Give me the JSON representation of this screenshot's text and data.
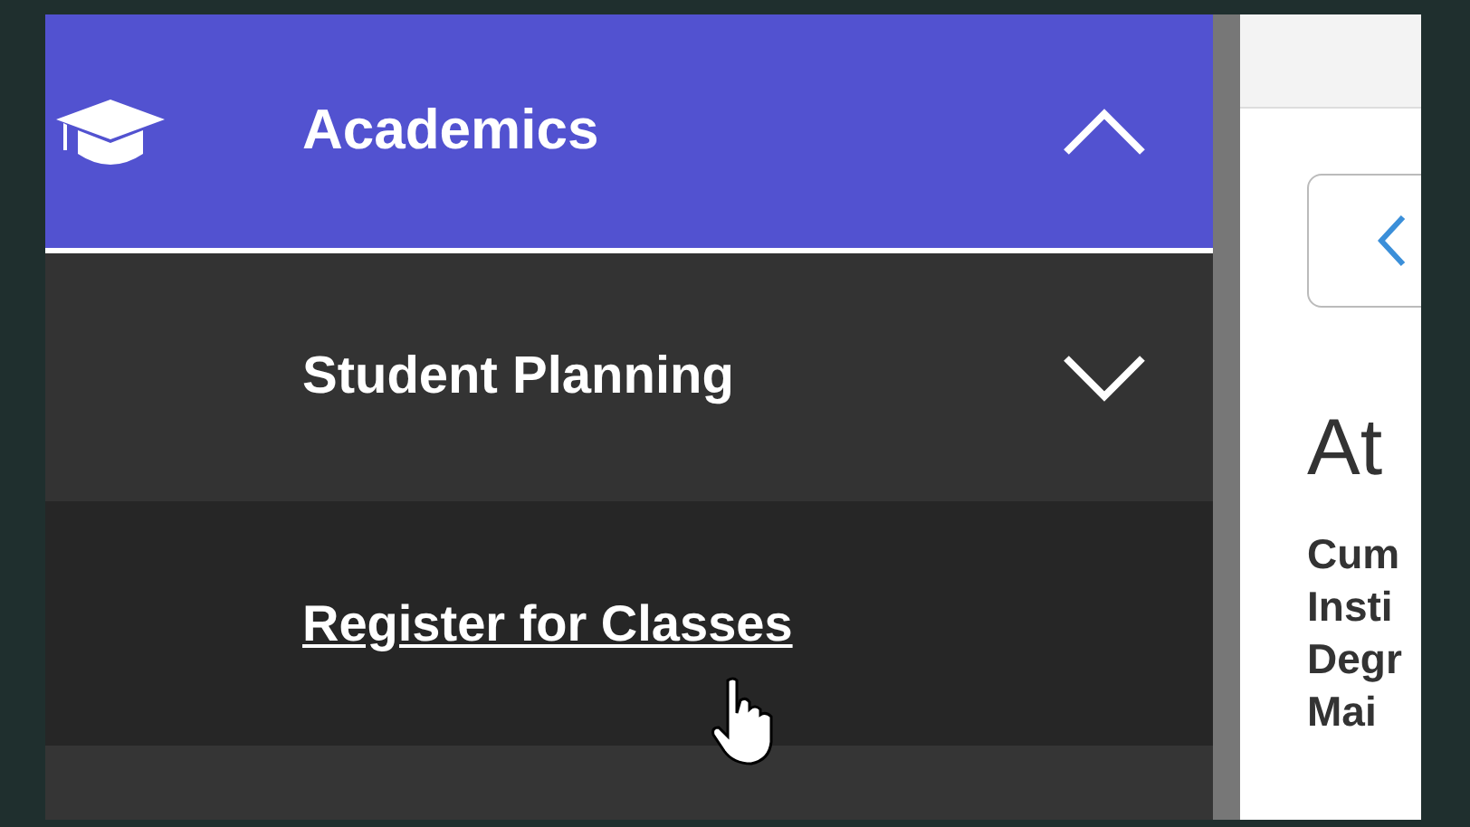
{
  "sidebar": {
    "items": [
      {
        "label": "Academics",
        "kind": "section",
        "expanded": true
      },
      {
        "label": "Student Planning",
        "kind": "subsection",
        "expanded": false
      },
      {
        "label": "Register for Classes",
        "kind": "link",
        "hovered": true
      }
    ]
  },
  "content": {
    "heading": "At",
    "summary_labels": [
      "Cum",
      "Insti",
      "Degr",
      "Mai"
    ]
  }
}
